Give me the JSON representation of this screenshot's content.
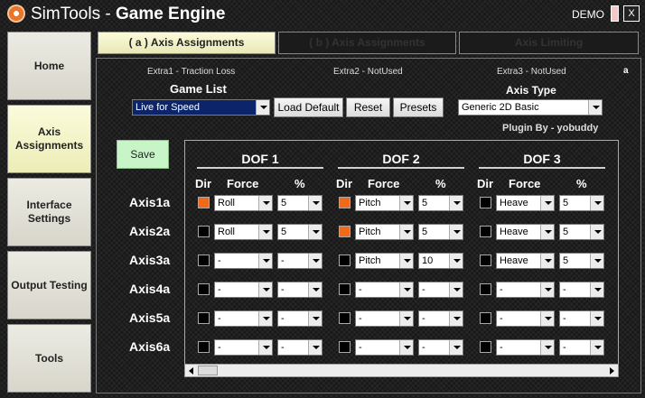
{
  "window": {
    "title_light": "SimTools - ",
    "title_bold": "Game Engine",
    "demo_label": "DEMO",
    "close_label": "X"
  },
  "sidebar": {
    "items": [
      {
        "label": "Home",
        "active": false
      },
      {
        "label": "Axis Assignments",
        "active": true
      },
      {
        "label": "Interface Settings",
        "active": false
      },
      {
        "label": "Output Testing",
        "active": false
      },
      {
        "label": "Tools",
        "active": false
      }
    ]
  },
  "tabs": [
    {
      "label": "( a ) Axis Assignments",
      "active": true
    },
    {
      "label": "( b ) Axis Assignments",
      "active": false
    },
    {
      "label": "Axis Limiting",
      "active": false
    }
  ],
  "extras": [
    "Extra1 - Traction Loss",
    "Extra2 - NotUsed",
    "Extra3 - NotUsed"
  ],
  "corner_mark": "a",
  "game_list": {
    "label": "Game List",
    "selected": "Live for Speed"
  },
  "buttons": {
    "load_default": "Load Default",
    "reset": "Reset",
    "presets": "Presets",
    "save": "Save"
  },
  "axis_type": {
    "label": "Axis Type",
    "selected": "Generic 2D Basic"
  },
  "plugin_by": "Plugin By - yobuddy",
  "columns": {
    "dir": "Dir",
    "force": "Force",
    "percent": "%"
  },
  "dofs": [
    "DOF 1",
    "DOF 2",
    "DOF 3"
  ],
  "colors": {
    "checked": "#f06a1c",
    "save": "#c8f5c8",
    "active_tab": "#fbfbdc"
  },
  "axes": [
    {
      "label": "Axis1a",
      "cells": [
        {
          "dir": true,
          "force": "Roll",
          "percent": "5"
        },
        {
          "dir": true,
          "force": "Pitch",
          "percent": "5"
        },
        {
          "dir": false,
          "force": "Heave",
          "percent": "5"
        }
      ]
    },
    {
      "label": "Axis2a",
      "cells": [
        {
          "dir": false,
          "force": "Roll",
          "percent": "5"
        },
        {
          "dir": true,
          "force": "Pitch",
          "percent": "5"
        },
        {
          "dir": false,
          "force": "Heave",
          "percent": "5"
        }
      ]
    },
    {
      "label": "Axis3a",
      "cells": [
        {
          "dir": false,
          "force": "-",
          "percent": "-"
        },
        {
          "dir": false,
          "force": "Pitch",
          "percent": "10"
        },
        {
          "dir": false,
          "force": "Heave",
          "percent": "5"
        }
      ]
    },
    {
      "label": "Axis4a",
      "cells": [
        {
          "dir": false,
          "force": "-",
          "percent": "-"
        },
        {
          "dir": false,
          "force": "-",
          "percent": "-"
        },
        {
          "dir": false,
          "force": "-",
          "percent": "-"
        }
      ]
    },
    {
      "label": "Axis5a",
      "cells": [
        {
          "dir": false,
          "force": "-",
          "percent": "-"
        },
        {
          "dir": false,
          "force": "-",
          "percent": "-"
        },
        {
          "dir": false,
          "force": "-",
          "percent": "-"
        }
      ]
    },
    {
      "label": "Axis6a",
      "cells": [
        {
          "dir": false,
          "force": "-",
          "percent": "-"
        },
        {
          "dir": false,
          "force": "-",
          "percent": "-"
        },
        {
          "dir": false,
          "force": "-",
          "percent": "-"
        }
      ]
    }
  ]
}
